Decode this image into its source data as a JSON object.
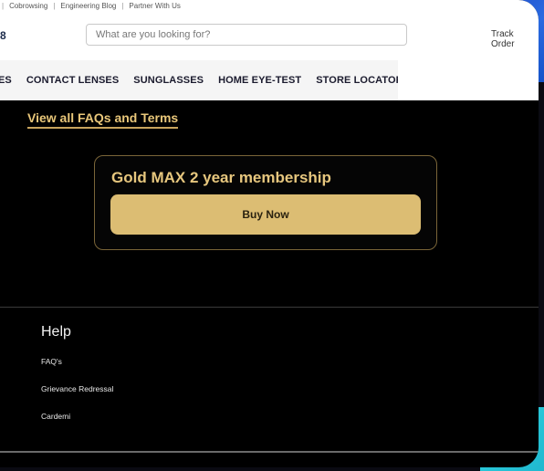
{
  "utility_bar": {
    "items": [
      "Cobrowsing",
      "Engineering Blog",
      "Partner With Us"
    ],
    "separator": "|"
  },
  "header": {
    "phone_fragment": "8",
    "search_placeholder": "What are you looking for?",
    "track_order": "Track Order"
  },
  "nav": {
    "items": [
      "ES",
      "CONTACT LENSES",
      "SUNGLASSES",
      "HOME EYE-TEST",
      "STORE LOCATOR"
    ]
  },
  "faq_link": "View all FAQs and Terms",
  "membership": {
    "title": "Gold MAX 2 year membership",
    "button": "Buy Now"
  },
  "help": {
    "title": "Help",
    "links": [
      "FAQ's",
      "Grievance Redressal",
      "Cardemi"
    ]
  },
  "colors": {
    "gold": "#dcbd73",
    "gold_text": "#e7c77e",
    "background": "#000000",
    "accent_blue": "#2a6ae0",
    "accent_cyan": "#2fd4e0"
  }
}
